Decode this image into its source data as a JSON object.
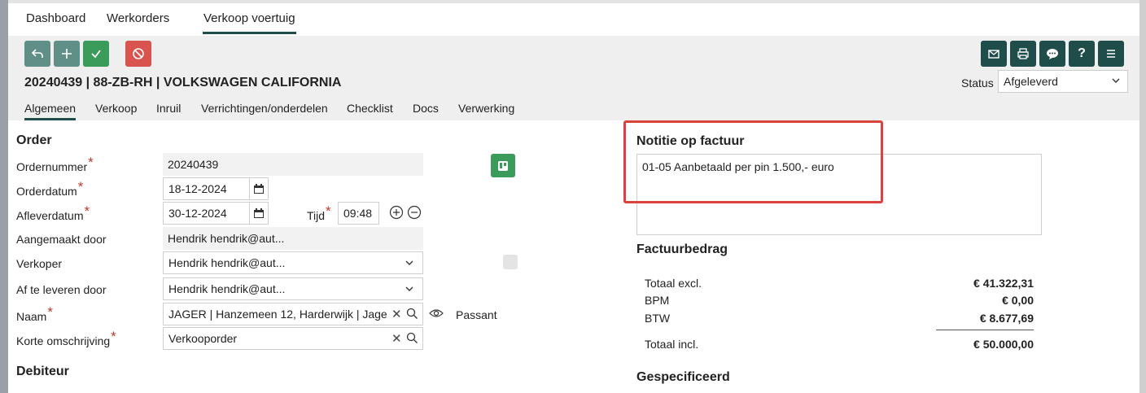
{
  "top_tabs": [
    "Dashboard",
    "Werkorders",
    "Verkoop voertuig"
  ],
  "toolbar": {
    "left_buttons": [
      "undo-icon",
      "plus-icon",
      "check-icon",
      "cancel-icon"
    ],
    "right_buttons": [
      "mail-icon",
      "print-icon",
      "chat-icon",
      "help-icon",
      "menu-icon"
    ]
  },
  "header": {
    "title": "20240439 | 88-ZB-RH | VOLKSWAGEN CALIFORNIA",
    "status_label": "Status",
    "status_value": "Afgeleverd"
  },
  "sub_tabs": [
    "Algemeen",
    "Verkoop",
    "Inruil",
    "Verrichtingen/onderdelen",
    "Checklist",
    "Docs",
    "Verwerking"
  ],
  "order": {
    "section_title": "Order",
    "ordernummer_label": "Ordernummer",
    "ordernummer_value": "20240439",
    "orderdatum_label": "Orderdatum",
    "orderdatum_value": "18-12-2024",
    "afleverdatum_label": "Afleverdatum",
    "afleverdatum_value": "30-12-2024",
    "tijd_label": "Tijd",
    "tijd_value": "09:48",
    "aangemaakt_label": "Aangemaakt door",
    "aangemaakt_value": "Hendrik hendrik@aut...",
    "verkoper_label": "Verkoper",
    "verkoper_value": "Hendrik hendrik@aut...",
    "af_te_leveren_label": "Af te leveren door",
    "af_te_leveren_value": "Hendrik hendrik@aut...",
    "naam_label": "Naam",
    "naam_value": "JAGER  | Hanzemeen 12, Harderwijk | Jage",
    "passant_label": "Passant",
    "korte_omschrijving_label": "Korte omschrijving",
    "korte_omschrijving_value": "Verkooporder",
    "debiteur_title": "Debiteur"
  },
  "notitie": {
    "title": "Notitie op factuur",
    "text": "01-05 Aanbetaald per pin 1.500,- euro"
  },
  "factuur": {
    "title": "Factuurbedrag",
    "totaal_excl_label": "Totaal excl.",
    "totaal_excl_value": "€ 41.322,31",
    "bpm_label": "BPM",
    "bpm_value": "€ 0,00",
    "btw_label": "BTW",
    "btw_value": "€ 8.677,69",
    "totaal_incl_label": "Totaal incl.",
    "totaal_incl_value": "€ 50.000,00"
  },
  "gespecificeerd_title": "Gespecificeerd",
  "colors": {
    "accent": "#1f4e4a",
    "success": "#3a9b5b",
    "danger": "#d9534f",
    "highlight": "#d9443e"
  }
}
